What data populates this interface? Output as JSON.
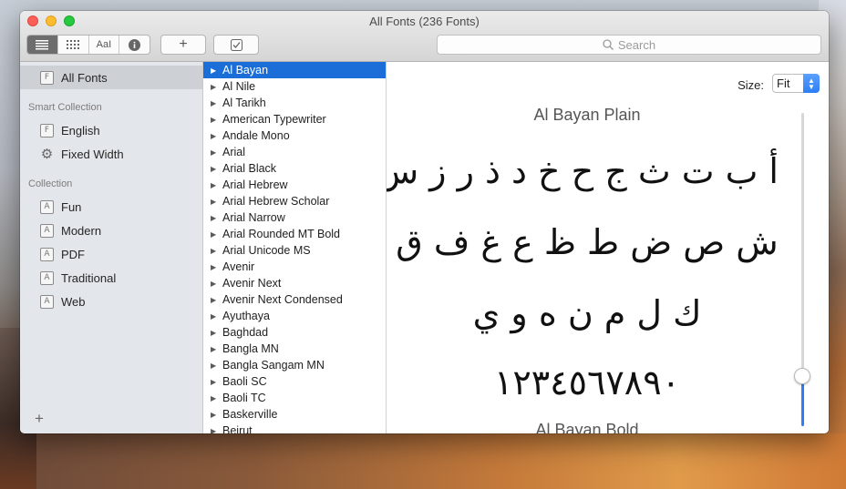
{
  "window": {
    "title": "All Fonts (236 Fonts)"
  },
  "toolbar": {
    "view_buttons": [
      "sample-view",
      "grid-view",
      "AaI",
      "info"
    ],
    "add_label": "+",
    "validate_label": "✓",
    "search_placeholder": "Search"
  },
  "sidebar": {
    "top_items": [
      {
        "label": "All Fonts",
        "selected": true
      }
    ],
    "smart_collection_header": "Smart Collection",
    "smart_items": [
      {
        "label": "English",
        "icon": "font-file-icon"
      },
      {
        "label": "Fixed Width",
        "icon": "gear-icon"
      }
    ],
    "collection_header": "Collection",
    "collection_items": [
      {
        "label": "Fun"
      },
      {
        "label": "Modern"
      },
      {
        "label": "PDF"
      },
      {
        "label": "Traditional"
      },
      {
        "label": "Web"
      }
    ],
    "add_label": "+"
  },
  "fonts": {
    "selected": "Al Bayan",
    "items": [
      "Al Bayan",
      "Al Nile",
      "Al Tarikh",
      "American Typewriter",
      "Andale Mono",
      "Arial",
      "Arial Black",
      "Arial Hebrew",
      "Arial Hebrew Scholar",
      "Arial Narrow",
      "Arial Rounded MT Bold",
      "Arial Unicode MS",
      "Avenir",
      "Avenir Next",
      "Avenir Next Condensed",
      "Ayuthaya",
      "Baghdad",
      "Bangla MN",
      "Bangla Sangam MN",
      "Baoli SC",
      "Baoli TC",
      "Baskerville",
      "Beirut"
    ]
  },
  "preview": {
    "size_label": "Size:",
    "size_value": "Fit",
    "title": "Al Bayan Plain",
    "next_title": "Al Bayan Bold",
    "lines": [
      "أ ب ت ث ج ح خ د ذ ر ز س",
      "ش ص ض ط ظ ع غ ف ق",
      "ك ل م ن ه و ي",
      "١٢٣٤٥٦٧٨٩٠"
    ]
  }
}
